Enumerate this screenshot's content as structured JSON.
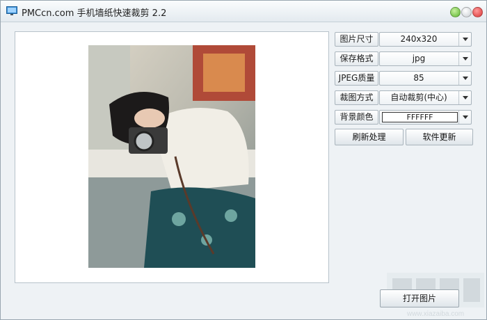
{
  "window": {
    "title": "PMCcn.com 手机墙纸快速裁剪 2.2"
  },
  "settings": [
    {
      "label": "图片尺寸",
      "value": "240x320"
    },
    {
      "label": "保存格式",
      "value": "jpg"
    },
    {
      "label": "JPEG质量",
      "value": "85"
    },
    {
      "label": "裁图方式",
      "value": "自动裁剪(中心)"
    },
    {
      "label": "背景颜色",
      "value": "FFFFFF"
    }
  ],
  "buttons": {
    "refresh": "刷新处理",
    "update": "软件更新",
    "open": "打开图片"
  },
  "watermark": {
    "url": "www.xiazaiba.com"
  },
  "colors": {
    "background": "#FFFFFF",
    "titlebar": "#E3EAEF",
    "accent": "#5BB52E"
  }
}
